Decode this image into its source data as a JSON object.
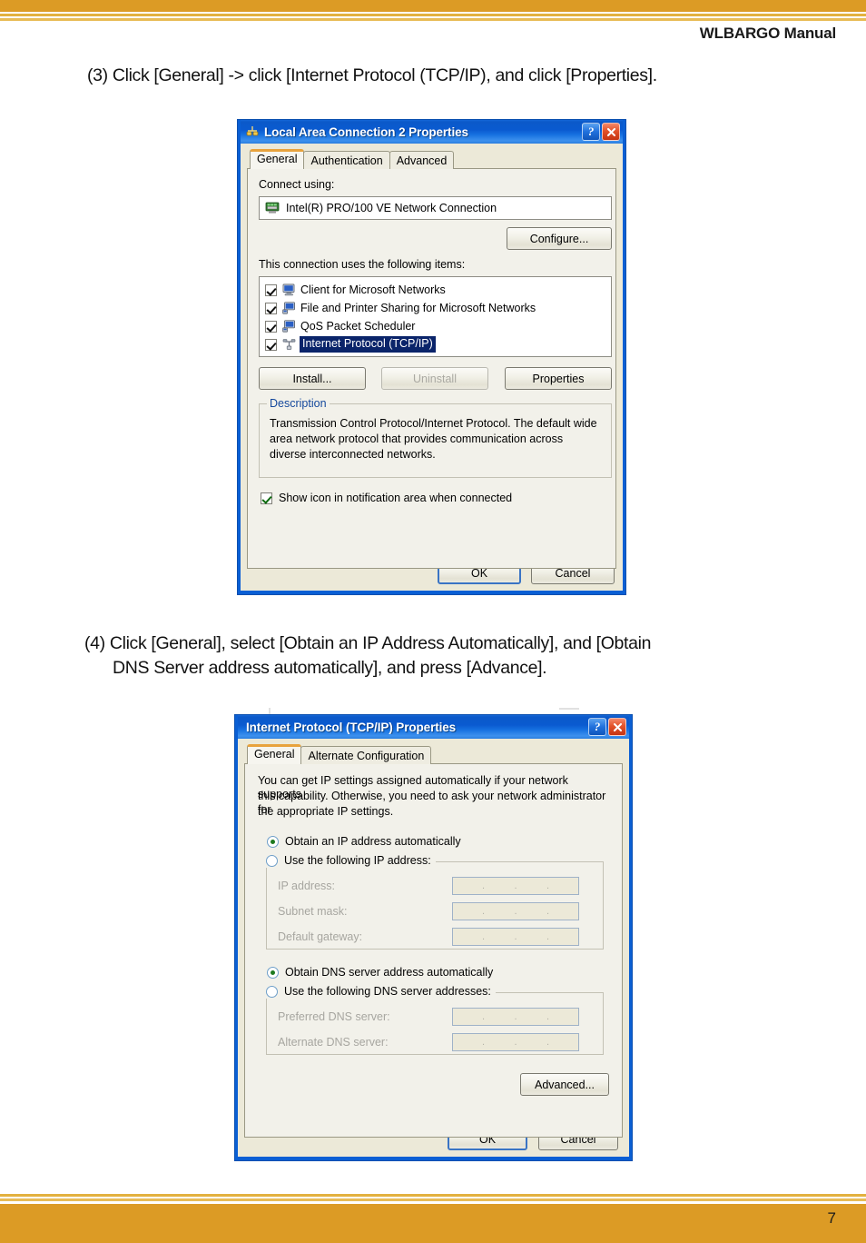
{
  "page": {
    "header_title": "WLBARGO Manual",
    "page_number": "7"
  },
  "steps": {
    "step3": "(3) Click [General] -> click [Internet Protocol (TCP/IP), and click [Properties].",
    "step4_line1": "(4) Click [General], select [Obtain an IP Address Automatically], and [Obtain",
    "step4_line2": "DNS Server address automatically], and press [Advance]."
  },
  "dialog_lac": {
    "title": "Local Area Connection 2 Properties",
    "title_icon": "network-connection-icon",
    "help_button": "?",
    "close_button": "x",
    "tabs": [
      {
        "label": "General",
        "active": true
      },
      {
        "label": "Authentication",
        "active": false
      },
      {
        "label": "Advanced",
        "active": false
      }
    ],
    "connect_using_label": "Connect using:",
    "adapter_name": "Intel(R) PRO/100 VE Network Connection",
    "adapter_icon": "network-adapter-icon",
    "configure_button": "Configure...",
    "items_label": "This connection uses the following items:",
    "items": [
      {
        "label": "Client for Microsoft Networks",
        "checked": true,
        "selected": false,
        "icon": "client-network-icon"
      },
      {
        "label": "File and Printer Sharing for Microsoft Networks",
        "checked": true,
        "selected": false,
        "icon": "file-printer-sharing-icon"
      },
      {
        "label": "QoS Packet Scheduler",
        "checked": true,
        "selected": false,
        "icon": "qos-scheduler-icon"
      },
      {
        "label": "Internet Protocol (TCP/IP)",
        "checked": true,
        "selected": true,
        "icon": "protocol-icon"
      }
    ],
    "install_button": "Install...",
    "uninstall_button": "Uninstall",
    "properties_button": "Properties",
    "description_title": "Description",
    "description_text": "Transmission Control Protocol/Internet Protocol. The default wide area network protocol that provides communication across diverse interconnected networks.",
    "show_icon_checkbox": "Show icon in notification area when connected",
    "show_icon_checked": true,
    "ok_button": "OK",
    "cancel_button": "Cancel"
  },
  "dialog_tcpip": {
    "title": "Internet Protocol (TCP/IP) Properties",
    "help_button": "?",
    "close_button": "x",
    "tabs": [
      {
        "label": "General",
        "active": true
      },
      {
        "label": "Alternate Configuration",
        "active": false
      }
    ],
    "intro_line1": "You can get IP settings assigned automatically if your network supports",
    "intro_line2": "this capability. Otherwise, you need to ask your network administrator for",
    "intro_line3": "the appropriate IP settings.",
    "radio_obtain_ip": "Obtain an IP address automatically",
    "radio_obtain_ip_selected": true,
    "radio_use_ip": "Use the following IP address:",
    "radio_use_ip_selected": false,
    "ip_address_label": "IP address:",
    "ip_address_value": "",
    "subnet_mask_label": "Subnet mask:",
    "subnet_mask_value": "",
    "default_gateway_label": "Default gateway:",
    "default_gateway_value": "",
    "radio_obtain_dns": "Obtain DNS server address automatically",
    "radio_obtain_dns_selected": true,
    "radio_use_dns": "Use the following DNS server addresses:",
    "radio_use_dns_selected": false,
    "preferred_dns_label": "Preferred DNS server:",
    "preferred_dns_value": "",
    "alternate_dns_label": "Alternate DNS server:",
    "alternate_dns_value": "",
    "advanced_button": "Advanced...",
    "ok_button": "OK",
    "cancel_button": "Cancel"
  },
  "colors": {
    "brand_orange": "#dc9b25",
    "brand_orange_light": "#e8bc56",
    "titlebar_blue": "#0a5fd4",
    "dialog_face": "#ece9d8",
    "selection_blue": "#0a246a",
    "link_blue": "#14489c"
  }
}
